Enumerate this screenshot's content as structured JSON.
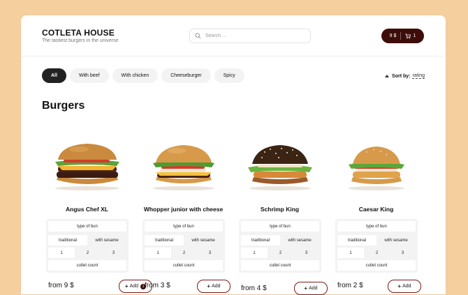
{
  "brand": {
    "title": "COTLETA HOUSE",
    "subtitle": "The tastiest burgers in the universe"
  },
  "search": {
    "placeholder": "Search ..."
  },
  "cart": {
    "total": "9 $",
    "count": "1"
  },
  "filters": [
    "All",
    "With beef",
    "With chicken",
    "Cheeseburger",
    "Spicy"
  ],
  "sort": {
    "label": "Sort by:",
    "value": "rating"
  },
  "section_title": "Burgers",
  "products": [
    {
      "name": "Angus Chef XL",
      "bun_label": "type of bun",
      "bun_options": [
        "traditional",
        "with sesame"
      ],
      "counts": [
        "1",
        "2",
        "3"
      ],
      "cutlet_label": "cutlet count",
      "price": "from 9 $",
      "add_label": "Add",
      "in_cart": "1"
    },
    {
      "name": "Whopper junior with cheese",
      "bun_label": "type of bun",
      "bun_options": [
        "traditional",
        "with sesame"
      ],
      "counts": [
        "1",
        "2",
        "3"
      ],
      "cutlet_label": "cutlet count",
      "price": "from 3 $",
      "add_label": "Add"
    },
    {
      "name": "Schrimp King",
      "bun_label": "type of bun",
      "bun_options": [
        "traditional",
        "with sesame"
      ],
      "counts": [
        "1",
        "2",
        "3"
      ],
      "cutlet_label": "cutlet count",
      "price": "from 4 $",
      "add_label": "Add"
    },
    {
      "name": "Caesar King",
      "bun_label": "type of bun",
      "bun_options": [
        "traditional",
        "with sesame"
      ],
      "counts": [
        "1",
        "2",
        "3"
      ],
      "cutlet_label": "cutlet count",
      "price": "from 2 $",
      "add_label": "Add"
    }
  ]
}
